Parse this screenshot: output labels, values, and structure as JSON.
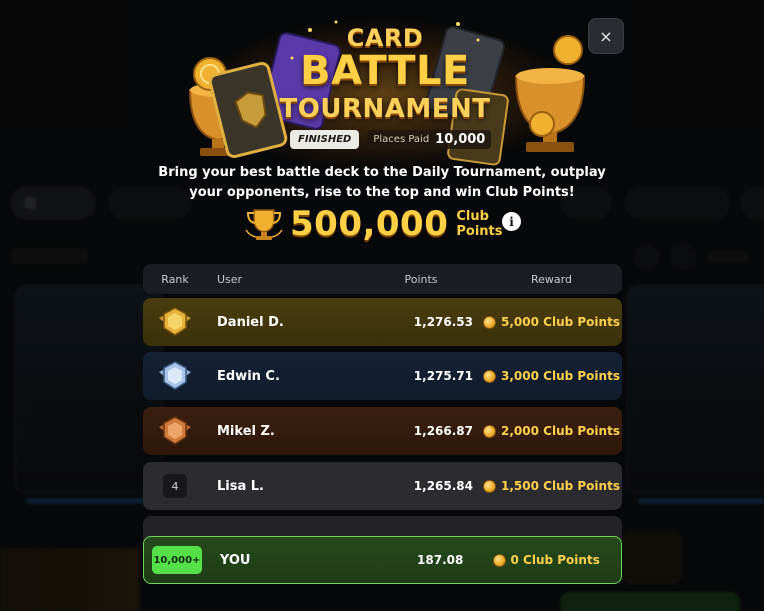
{
  "header": {
    "title_line1": "CARD",
    "title_line2": "BATTLE",
    "title_line3": "TOURNAMENT",
    "status": "FINISHED",
    "places_paid_label": "Places Paid",
    "places_paid_value": "10,000",
    "close_label": "×"
  },
  "description": "Bring your best battle deck to the Daily Tournament, outplay your opponents, rise to the top and win Club Points!",
  "prize": {
    "amount": "500,000",
    "unit_line1": "Club",
    "unit_line2": "Points",
    "info_label": "i"
  },
  "leaderboard": {
    "columns": {
      "rank": "Rank",
      "user": "User",
      "points": "Points",
      "reward": "Reward"
    },
    "rows": [
      {
        "rank": "1",
        "user": "Daniel D.",
        "points": "1,276.53",
        "reward": "5,000 Club Points"
      },
      {
        "rank": "2",
        "user": "Edwin C.",
        "points": "1,275.71",
        "reward": "3,000 Club Points"
      },
      {
        "rank": "3",
        "user": "Mikel Z.",
        "points": "1,266.87",
        "reward": "2,000 Club Points"
      },
      {
        "rank": "4",
        "user": "Lisa L.",
        "points": "1,265.84",
        "reward": "1,500 Club Points"
      }
    ],
    "you": {
      "rank": "10,000+",
      "user": "YOU",
      "points": "187.08",
      "reward": "0 Club Points"
    }
  },
  "colors": {
    "accent_gold": "#ffcf45",
    "you_highlight": "#55e04a",
    "first_row": "#4a3d0e",
    "second_row": "#152236",
    "third_row": "#3b1f0e"
  }
}
